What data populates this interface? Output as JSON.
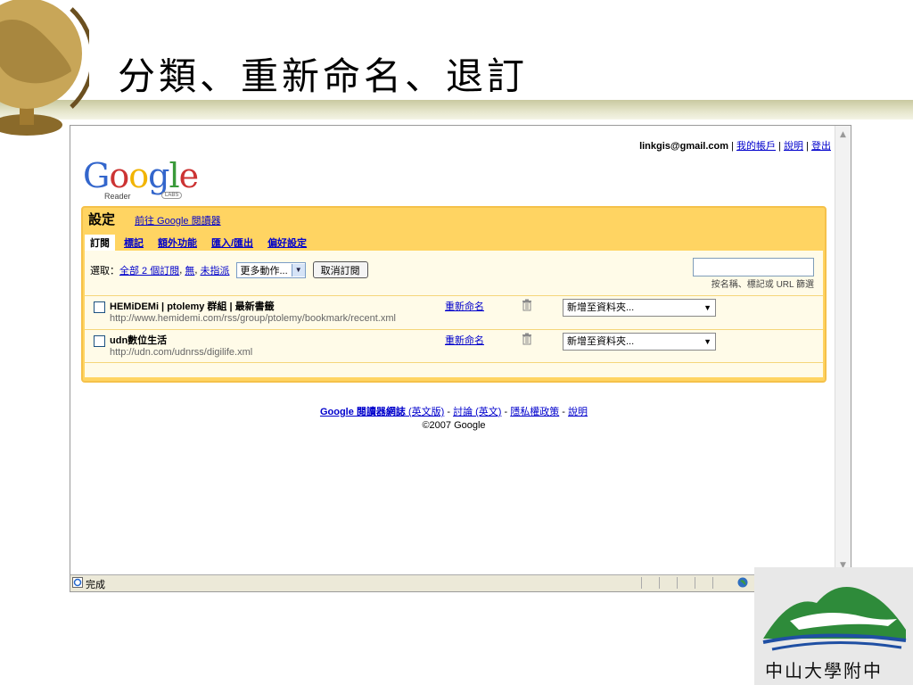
{
  "slide": {
    "title": "分類、重新命名、退訂"
  },
  "browser": {
    "topbar": {
      "email": "linkgis@gmail.com",
      "sep": "|",
      "links": [
        "我的帳戶",
        "說明",
        "登出"
      ]
    },
    "logo": {
      "letters": [
        "G",
        "o",
        "o",
        "g",
        "l",
        "e"
      ],
      "sub": "Reader",
      "labs": "LABS"
    },
    "settings": {
      "title": "設定",
      "goto_link": "前往 Google 閱讀器",
      "tabs": [
        {
          "label": "訂閱",
          "active": true
        },
        {
          "label": "標記",
          "active": false
        },
        {
          "label": "額外功能",
          "active": false
        },
        {
          "label": "匯入/匯出",
          "active": false
        },
        {
          "label": "偏好設定",
          "active": false
        }
      ],
      "toolbar": {
        "select_label": "選取：",
        "all_link": "全部 2 個訂閱",
        "comma1": ",",
        "none_link": "無",
        "comma2": ",",
        "unassigned_link": "未指派",
        "more_actions": "更多動作...",
        "unsubscribe_button": "取消訂閱"
      },
      "filter": {
        "placeholder": "",
        "label": "按名稱、標記或 URL 篩選"
      },
      "subscriptions": [
        {
          "title": "HEMiDEMi | ptolemy 群組 | 最新書籤",
          "url": "http://www.hemidemi.com/rss/group/ptolemy/bookmark/recent.xml",
          "rename": "重新命名",
          "folder": "新增至資料夾..."
        },
        {
          "title": "udn數位生活",
          "url": "http://udn.com/udnrss/digilife.xml",
          "rename": "重新命名",
          "folder": "新增至資料夾..."
        }
      ]
    },
    "footer": {
      "blog": "Google 閱讀器網誌",
      "blog_en": "(英文版)",
      "dash1": " - ",
      "discuss": "討論 (英文)",
      "dash2": " - ",
      "privacy": "隱私權政策",
      "dash3": " - ",
      "help": "說明",
      "copyright": "©2007 Google"
    },
    "statusbar": {
      "text": "完成"
    }
  },
  "school": {
    "name": "中山大學附中"
  }
}
